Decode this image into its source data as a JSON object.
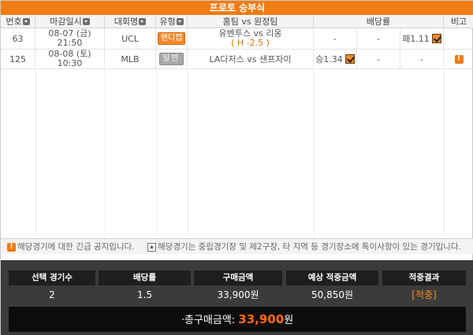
{
  "title": "프로토 승부식",
  "headers": {
    "no": "번호",
    "deadline": "마감일시",
    "league": "대회명",
    "type": "유형",
    "match": "홈팀 vs 원정팀",
    "odds": "배당률",
    "note": "비고"
  },
  "rows": [
    {
      "no": "63",
      "date": "08-07 (금)",
      "time": "21:50",
      "league": "UCL",
      "type": "핸디캡",
      "type_style": "orange",
      "match": "유벤투스 vs 리옹",
      "handicap": "( H -2.5 )",
      "odds_win": "-",
      "odds_draw": "-",
      "odds_lose": "패1.11",
      "selected": "lose",
      "note_alert": false
    },
    {
      "no": "125",
      "date": "08-08 (토)",
      "time": "10:30",
      "league": "MLB",
      "type": "일반",
      "type_style": "gray",
      "match": "LA다저스 vs 샌프자이",
      "handicap": "",
      "odds_win": "승1.34",
      "odds_draw": "-",
      "odds_lose": "-",
      "selected": "win",
      "note_alert": true
    }
  ],
  "notices": {
    "urgent": "해당경기에 대한 긴급 공지입니다.",
    "special": "해당경기는 중립경기장 및 제2구장, 타 지역 등 경기장소에 특이사항이 있는 경기입니다."
  },
  "summary": {
    "labels": [
      "선택 경기수",
      "배당률",
      "구매금액",
      "예상 적중금액",
      "적중결과"
    ],
    "values": [
      "2",
      "1.5",
      "33,900원",
      "50,850원",
      "[적중]"
    ],
    "total_label": "·총구매금액:",
    "total_amount": "33,900",
    "total_unit": "원"
  },
  "colors": {
    "accent": "#ef7d12",
    "result": "#ff8a1c"
  }
}
